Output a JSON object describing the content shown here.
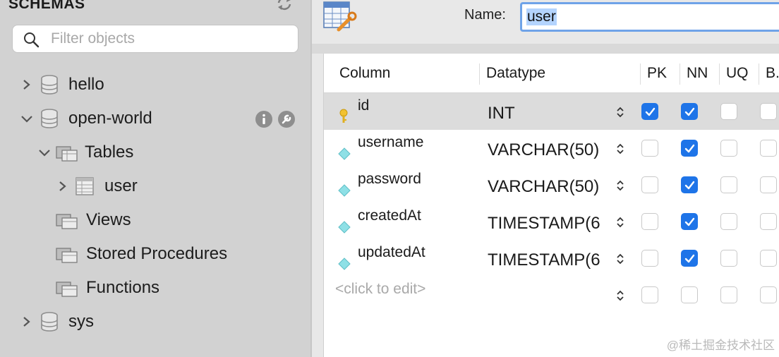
{
  "sidebar": {
    "header": "SCHEMAS",
    "search_placeholder": "Filter objects",
    "tree": {
      "hello": "hello",
      "open_world": "open-world",
      "tables": "Tables",
      "user": "user",
      "views": "Views",
      "stored_procedures": "Stored Procedures",
      "functions": "Functions",
      "sys": "sys"
    }
  },
  "editor": {
    "name_label": "Name:",
    "name_value": "user",
    "columns": {
      "column": "Column",
      "datatype": "Datatype",
      "pk": "PK",
      "nn": "NN",
      "uq": "UQ",
      "b": "B."
    },
    "rows": [
      {
        "name": "id",
        "type": "INT",
        "pk": true,
        "nn": true,
        "uq": false,
        "b": false,
        "icon": "key-icon",
        "selected": true
      },
      {
        "name": "username",
        "type": "VARCHAR(50)",
        "pk": false,
        "nn": true,
        "uq": false,
        "b": false,
        "icon": "column-diamond-icon",
        "selected": false
      },
      {
        "name": "password",
        "type": "VARCHAR(50)",
        "pk": false,
        "nn": true,
        "uq": false,
        "b": false,
        "icon": "column-diamond-icon",
        "selected": false
      },
      {
        "name": "createdAt",
        "type": "TIMESTAMP(6",
        "pk": false,
        "nn": true,
        "uq": false,
        "b": false,
        "icon": "column-diamond-icon",
        "selected": false
      },
      {
        "name": "updatedAt",
        "type": "TIMESTAMP(6",
        "pk": false,
        "nn": true,
        "uq": false,
        "b": false,
        "icon": "column-diamond-icon",
        "selected": false
      }
    ],
    "new_row_placeholder": "<click to edit>"
  },
  "watermark": "@稀土掘金技术社区",
  "colors": {
    "accent": "#1e74e8",
    "selection": "#b4d4fe",
    "sidebar_bg": "#d2d2d2"
  }
}
